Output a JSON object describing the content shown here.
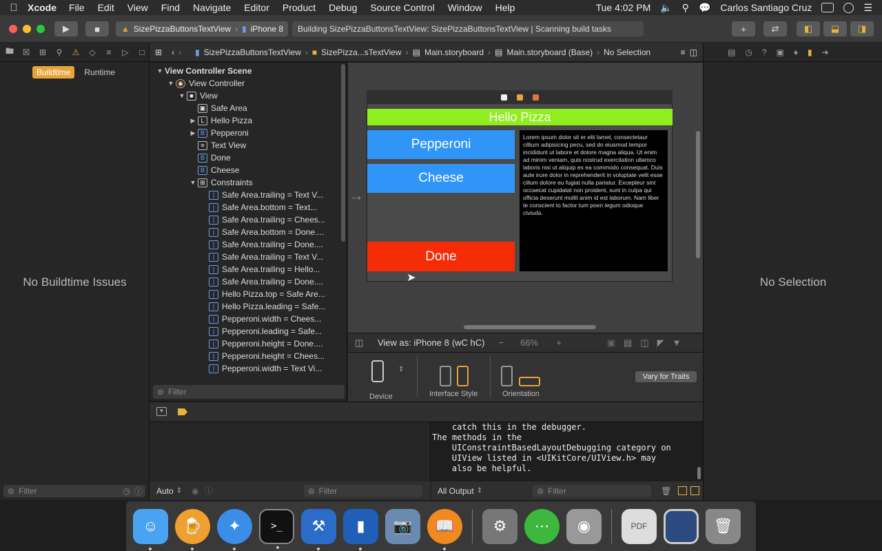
{
  "menubar": {
    "app_name": "Xcode",
    "menus": [
      "File",
      "Edit",
      "View",
      "Find",
      "Navigate",
      "Editor",
      "Product",
      "Debug",
      "Source Control",
      "Window",
      "Help"
    ],
    "clock": "Tue 4:02 PM",
    "user": "Carlos Santiago Cruz"
  },
  "toolbar": {
    "scheme": "SizePizzaButtonsTextView",
    "destination": "iPhone 8",
    "activity": "Building SizePizzaButtonsTextView: SizePizzaButtonsTextView | Scanning build tasks"
  },
  "navigator": {
    "scope_buildtime": "Buildtime",
    "scope_runtime": "Runtime",
    "empty_message": "No Buildtime Issues",
    "filter_placeholder": "Filter"
  },
  "jumpbar": {
    "items": [
      "SizePizzaButtonsTextView",
      "SizePizza...sTextView",
      "Main.storyboard",
      "Main.storyboard (Base)",
      "No Selection"
    ]
  },
  "outline": {
    "rows": [
      {
        "label": "View Controller Scene",
        "icon": "scene-icon"
      },
      {
        "label": "View Controller",
        "icon": "view-controller-icon"
      },
      {
        "label": "View",
        "icon": "view-icon"
      },
      {
        "label": "Safe Area",
        "icon": "safe-area-icon"
      },
      {
        "label": "Hello Pizza",
        "icon": "label-icon"
      },
      {
        "label": "Pepperoni",
        "icon": "button-icon"
      },
      {
        "label": "Text View",
        "icon": "text-view-icon"
      },
      {
        "label": "Done",
        "icon": "button-icon"
      },
      {
        "label": "Cheese",
        "icon": "button-icon"
      },
      {
        "label": "Constraints",
        "icon": "constraints-icon"
      },
      {
        "label": "Safe Area.trailing = Text V...",
        "icon": "constraint-icon"
      },
      {
        "label": "Safe Area.bottom = Text...",
        "icon": "constraint-icon"
      },
      {
        "label": "Safe Area.trailing = Chees...",
        "icon": "constraint-icon"
      },
      {
        "label": "Safe Area.bottom = Done....",
        "icon": "constraint-icon"
      },
      {
        "label": "Safe Area.trailing = Done....",
        "icon": "constraint-icon"
      },
      {
        "label": "Safe Area.trailing = Text V...",
        "icon": "constraint-icon"
      },
      {
        "label": "Safe Area.trailing = Hello...",
        "icon": "constraint-icon"
      },
      {
        "label": "Safe Area.trailing = Done....",
        "icon": "constraint-icon"
      },
      {
        "label": "Hello Pizza.top = Safe Are...",
        "icon": "constraint-icon"
      },
      {
        "label": "Hello Pizza.leading = Safe...",
        "icon": "constraint-icon"
      },
      {
        "label": "Pepperoni.width = Chees...",
        "icon": "constraint-icon"
      },
      {
        "label": "Pepperoni.leading = Safe...",
        "icon": "constraint-icon"
      },
      {
        "label": "Pepperoni.height = Done....",
        "icon": "constraint-icon"
      },
      {
        "label": "Pepperoni.height = Chees...",
        "icon": "constraint-icon"
      },
      {
        "label": "Pepperoni.width = Text Vi...",
        "icon": "constraint-icon"
      }
    ],
    "filter_placeholder": "Filter"
  },
  "canvas": {
    "title_label": "Hello Pizza",
    "buttons": [
      "Pepperoni",
      "Cheese",
      "Done"
    ],
    "text_view": "Lorem ipsum dolor sit er elit lamet, consectetaur cillium adipisicing pecu, sed do eiusmod tempor incididunt ut labore et dolore magna aliqua. Ut enim ad minim veniam, quis nostrud exercitation ullamco laboris nisi ut aliquip ex ea commodo consequat. Duis aute irure dolor in reprehenderit in voluptate velit esse cillum dolore eu fugiat nulla pariatur. Excepteur sint occaecat cupidatat non proident, sunt in culpa qui officia deserunt mollit anim id est laborum. Nam liber te conscient to factor tum poen legum odioque civiuda.",
    "colors": {
      "hello": "#8fee1d",
      "pepperoni": "#2f95f6",
      "cheese": "#2f95f6",
      "done": "#f52c05"
    }
  },
  "viewas": {
    "label": "View as: iPhone 8",
    "traits": "(wC hC)",
    "zoom": "66%"
  },
  "device_config": {
    "device": "Device",
    "interface_style": "Interface Style",
    "orientation": "Orientation",
    "vary": "Vary for Traits"
  },
  "debug": {
    "console_text": "    catch this in the debugger.\nThe methods in the\n    UIConstraintBasedLayoutDebugging category on\n    UIView listed in <UIKitCore/UIView.h> may\n    also be helpful.",
    "auto_label": "Auto",
    "vars_filter": "Filter",
    "output_label": "All Output",
    "console_filter": "Filter"
  },
  "inspector": {
    "empty_message": "No Selection"
  },
  "dock": {
    "apps": [
      "Finder",
      "Beer",
      "Safari",
      "Terminal",
      "Xcode",
      "Simulator",
      "Preview",
      "Books",
      "System Preferences",
      "Messages",
      "Disk Utility",
      "PDF",
      "Screenshot",
      "Trash"
    ]
  }
}
